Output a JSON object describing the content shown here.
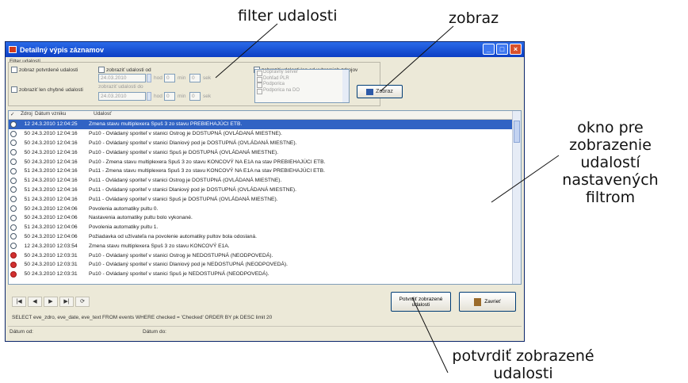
{
  "annotations": {
    "filter": "filter udalosti",
    "zobraz": "zobraz",
    "okno": [
      "okno pre zobrazenie",
      "udalostí nastavených",
      "filtrom"
    ],
    "potvrdit": [
      "potvrdiť zobrazené",
      "udalosti"
    ]
  },
  "window": {
    "title": "Detailný výpis záznamov",
    "buttons": [
      "_",
      "□",
      "×"
    ]
  },
  "filter": {
    "group_title": "Filter udalostí",
    "cb_potvrdene": "zobraz potvrdené udalosti",
    "cb_len_chybne": "zobraziť len chybné udalosti",
    "cb_od": "zobraziť udalosti od",
    "cb_zdroje": "zobraziť udalosti len od vybraných zdrojov",
    "date_from": "24.03.2010",
    "date_to": "24.03.2010",
    "lbl_do": "zobraziť udalosti do",
    "lbl_hod": "hod",
    "lbl_min": "min",
    "lbl_sek": "sek",
    "h1": "0",
    "m1": "0",
    "h2": "0",
    "m2": "0",
    "sources": [
      "Dopravný server",
      "Dohľad PLR",
      "Podporica",
      "Podporica na DO"
    ],
    "btn_zobraz": "Zobraz"
  },
  "grid": {
    "headers": [
      "Zdroj",
      "Dátum vzniku",
      "Udalosť"
    ],
    "rows": [
      {
        "icon": "info",
        "zdroj": "12",
        "date": "24.3.2010 12:04:25",
        "msg": "Zmena stavu multiplexera Spuš 3 zo stavu PREBIEHAJÚCI ETB.",
        "selected": true
      },
      {
        "icon": "info",
        "zdroj": "50",
        "date": "24.3.2010 12:04:16",
        "msg": "Pu10 - Ovládaný sporiteľ v stanici Ostrog je DOSTUPNÁ (OVLÁDANÁ MIESTNE)."
      },
      {
        "icon": "info",
        "zdroj": "50",
        "date": "24.3.2010 12:04:16",
        "msg": "Pu10 - Ovládaný sporiteľ v stanici Dlaniový pod je DOSTUPNÁ (OVLÁDANÁ MIESTNE)."
      },
      {
        "icon": "info",
        "zdroj": "50",
        "date": "24.3.2010 12:04:16",
        "msg": "Pu10 - Ovládaný sporiteľ v stanici Spuš je DOSTUPNÁ (OVLÁDANÁ MIESTNE)."
      },
      {
        "icon": "info",
        "zdroj": "50",
        "date": "24.3.2010 12:04:16",
        "msg": "Pu10 - Zmena stavu multiplexera Spuš 3 zo stavu KONCOVÝ NA E1A na stav PREBIEHAJÚCI ETB."
      },
      {
        "icon": "info",
        "zdroj": "51",
        "date": "24.3.2010 12:04:16",
        "msg": "Pu11 - Zmena stavu multiplexera Spuš 3 zo stavu KONCOVÝ NA E1A na stav PREBIEHAJÚCI ETB."
      },
      {
        "icon": "info",
        "zdroj": "51",
        "date": "24.3.2010 12:04:16",
        "msg": "Pu11 - Ovládaný sporiteľ v stanici Ostrog je DOSTUPNÁ (OVLÁDANÁ MIESTNE)."
      },
      {
        "icon": "info",
        "zdroj": "51",
        "date": "24.3.2010 12:04:16",
        "msg": "Pu11 - Ovládaný sporiteľ v stanici Dlaniový pod je DOSTUPNÁ (OVLÁDANÁ MIESTNE)."
      },
      {
        "icon": "info",
        "zdroj": "51",
        "date": "24.3.2010 12:04:16",
        "msg": "Pu11 - Ovládaný sporiteľ v stanici Spuš je DOSTUPNÁ (OVLÁDANÁ MIESTNE)."
      },
      {
        "icon": "info",
        "zdroj": "50",
        "date": "24.3.2010 12:04:06",
        "msg": "Povolenia automatiky pultu 0."
      },
      {
        "icon": "info",
        "zdroj": "50",
        "date": "24.3.2010 12:04:06",
        "msg": "Nastavenia automatiky pultu bolo vykonané."
      },
      {
        "icon": "info",
        "zdroj": "51",
        "date": "24.3.2010 12:04:06",
        "msg": "Povolenia automatiky pultu 1."
      },
      {
        "icon": "info",
        "zdroj": "50",
        "date": "24.3.2010 12:04:06",
        "msg": "Požiadavka od užívateľa na povolenie automatiky pultov bola odoslaná."
      },
      {
        "icon": "info",
        "zdroj": "12",
        "date": "24.3.2010 12:03:54",
        "msg": "Zmena stavu multiplexera Spuš 3 zo stavu KONCOVÝ E1A."
      },
      {
        "icon": "err",
        "zdroj": "50",
        "date": "24.3.2010 12:03:31",
        "msg": "Pu10 - Ovládaný sporiteľ v stanici Ostrog je NEDOSTUPNÁ (NEODPOVEDÁ)."
      },
      {
        "icon": "err",
        "zdroj": "50",
        "date": "24.3.2010 12:03:31",
        "msg": "Pu10 - Ovládaný sporiteľ v stanici Dlaniový pod je NEDOSTUPNÁ (NEODPOVEDÁ)."
      },
      {
        "icon": "err",
        "zdroj": "50",
        "date": "24.3.2010 12:03:31",
        "msg": "Pu10 - Ovládaný sporiteľ v stanici Spuš je NEDOSTUPNÁ (NEODPOVEDÁ)."
      }
    ]
  },
  "bottom": {
    "nav": [
      "|◀",
      "◀",
      "▶",
      "▶|",
      "⟳"
    ],
    "btn_potvrdit": "Potvrdiť zobrazené udalosti",
    "btn_zavriet": "Zavrieť",
    "sql": "SELECT eve_zdro, eve_date, eve_text FROM events WHERE checked = 'Checked' ORDER BY pk DESC limit 20",
    "status_datum": "Dátum od:",
    "status_do": "Dátum do:"
  }
}
